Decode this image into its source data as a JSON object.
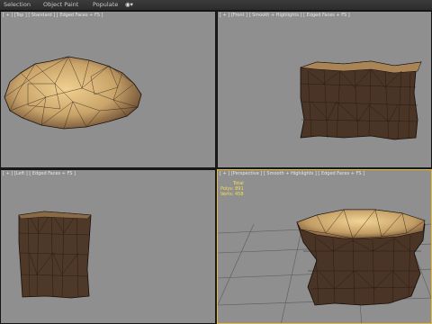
{
  "ribbon": {
    "tabs": [
      "Selection",
      "Object Paint",
      "Populate"
    ],
    "extra_icon": "eye-icon"
  },
  "viewports": {
    "top": {
      "label": "[ + ] [Top ] [ Standard ] [ Edged Faces + FS ]"
    },
    "front": {
      "label": "[ + ] [Front ] [ Smooth + Highlights ] [ Edged Faces + FS ]"
    },
    "left": {
      "label": "[ + ] [Left ] [ Edged Faces + FS ]"
    },
    "perspective": {
      "label": "[ + ] [Perspective ] [ Smooth + Highlights ] [ Edged Faces + FS ]",
      "stats_total": "Total",
      "stats_polys": "Polys: 891",
      "stats_verts": "Verts: 458"
    }
  },
  "colors": {
    "viewport_bg": "#8f8f8f",
    "active_border": "#e5b83a",
    "bark": "#4a3426",
    "wood_top": "#c9a870",
    "stats_text": "#f2e04a"
  }
}
